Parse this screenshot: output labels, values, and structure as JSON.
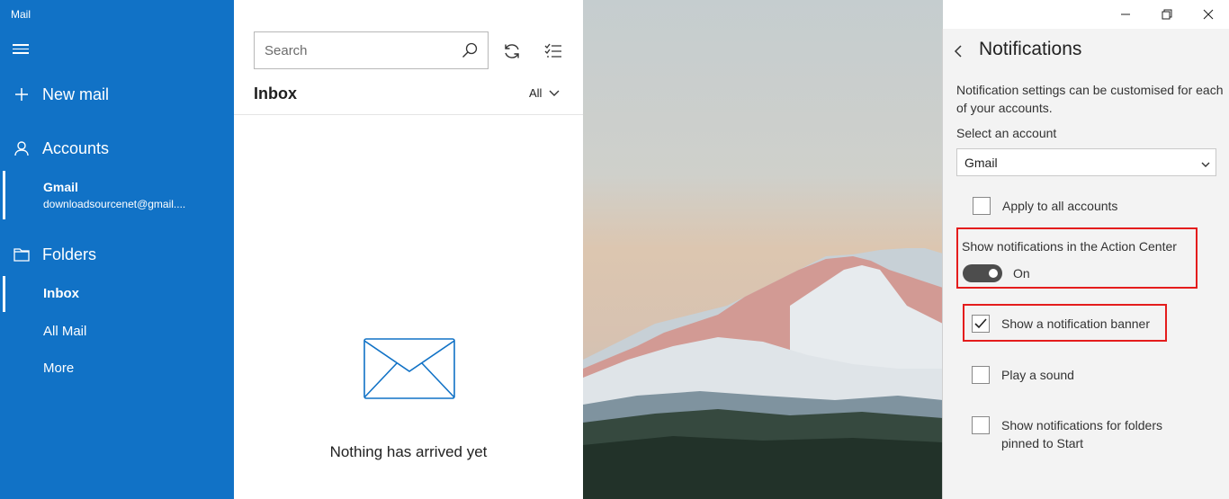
{
  "app": {
    "title": "Mail"
  },
  "sidebar": {
    "new_mail": "New mail",
    "accounts_label": "Accounts",
    "account": {
      "name": "Gmail",
      "email": "downloadsourcenet@gmail...."
    },
    "folders_label": "Folders",
    "folders": [
      {
        "label": "Inbox"
      },
      {
        "label": "All Mail"
      },
      {
        "label": "More"
      }
    ]
  },
  "list": {
    "search_placeholder": "Search",
    "title": "Inbox",
    "filter": "All",
    "empty_message": "Nothing has arrived yet"
  },
  "panel": {
    "title": "Notifications",
    "description": "Notification settings can be customised for each of your accounts.",
    "select_label": "Select an account",
    "selected_account": "Gmail",
    "apply_all": "Apply to all accounts",
    "action_center_label": "Show notifications in the Action Center",
    "toggle_state": "On",
    "banner": "Show a notification banner",
    "sound": "Play a sound",
    "pinned_folders": "Show notifications for folders pinned to Start"
  },
  "state": {
    "apply_all_checked": false,
    "action_center_on": true,
    "banner_checked": true,
    "sound_checked": false,
    "pinned_folders_checked": false
  },
  "colors": {
    "accent": "#1172c6",
    "highlight": "#e41c1c",
    "toggle_on": "#4d4d4d",
    "panel_bg": "#f3f3f3"
  },
  "icons": [
    "hamburger-icon",
    "plus-icon",
    "person-icon",
    "folder-icon",
    "search-icon",
    "sync-icon",
    "select-checklist-icon",
    "chevron-down-icon",
    "envelope-icon",
    "minimize-icon",
    "restore-icon",
    "close-icon",
    "back-arrow-icon",
    "checkmark-icon"
  ]
}
